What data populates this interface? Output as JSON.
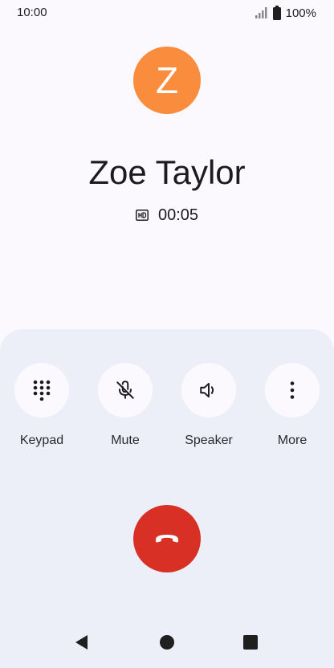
{
  "status_bar": {
    "time": "10:00",
    "battery": "100%",
    "signal_icon": "cellular-signal-icon",
    "battery_icon": "battery-full-icon"
  },
  "contact": {
    "initial": "Z",
    "name": "Zoe Taylor",
    "avatar_color": "#f98d3d"
  },
  "call": {
    "hd_icon": "hd-call-icon",
    "duration": "00:05"
  },
  "controls": [
    {
      "label": "Keypad",
      "icon": "keypad-icon"
    },
    {
      "label": "Mute",
      "icon": "mic-off-icon"
    },
    {
      "label": "Speaker",
      "icon": "speaker-icon"
    },
    {
      "label": "More",
      "icon": "more-vertical-icon"
    }
  ],
  "end_call": {
    "icon": "end-call-icon",
    "color": "#d93025"
  },
  "nav": {
    "back_icon": "back-icon",
    "home_icon": "home-icon",
    "recents_icon": "recents-icon"
  }
}
